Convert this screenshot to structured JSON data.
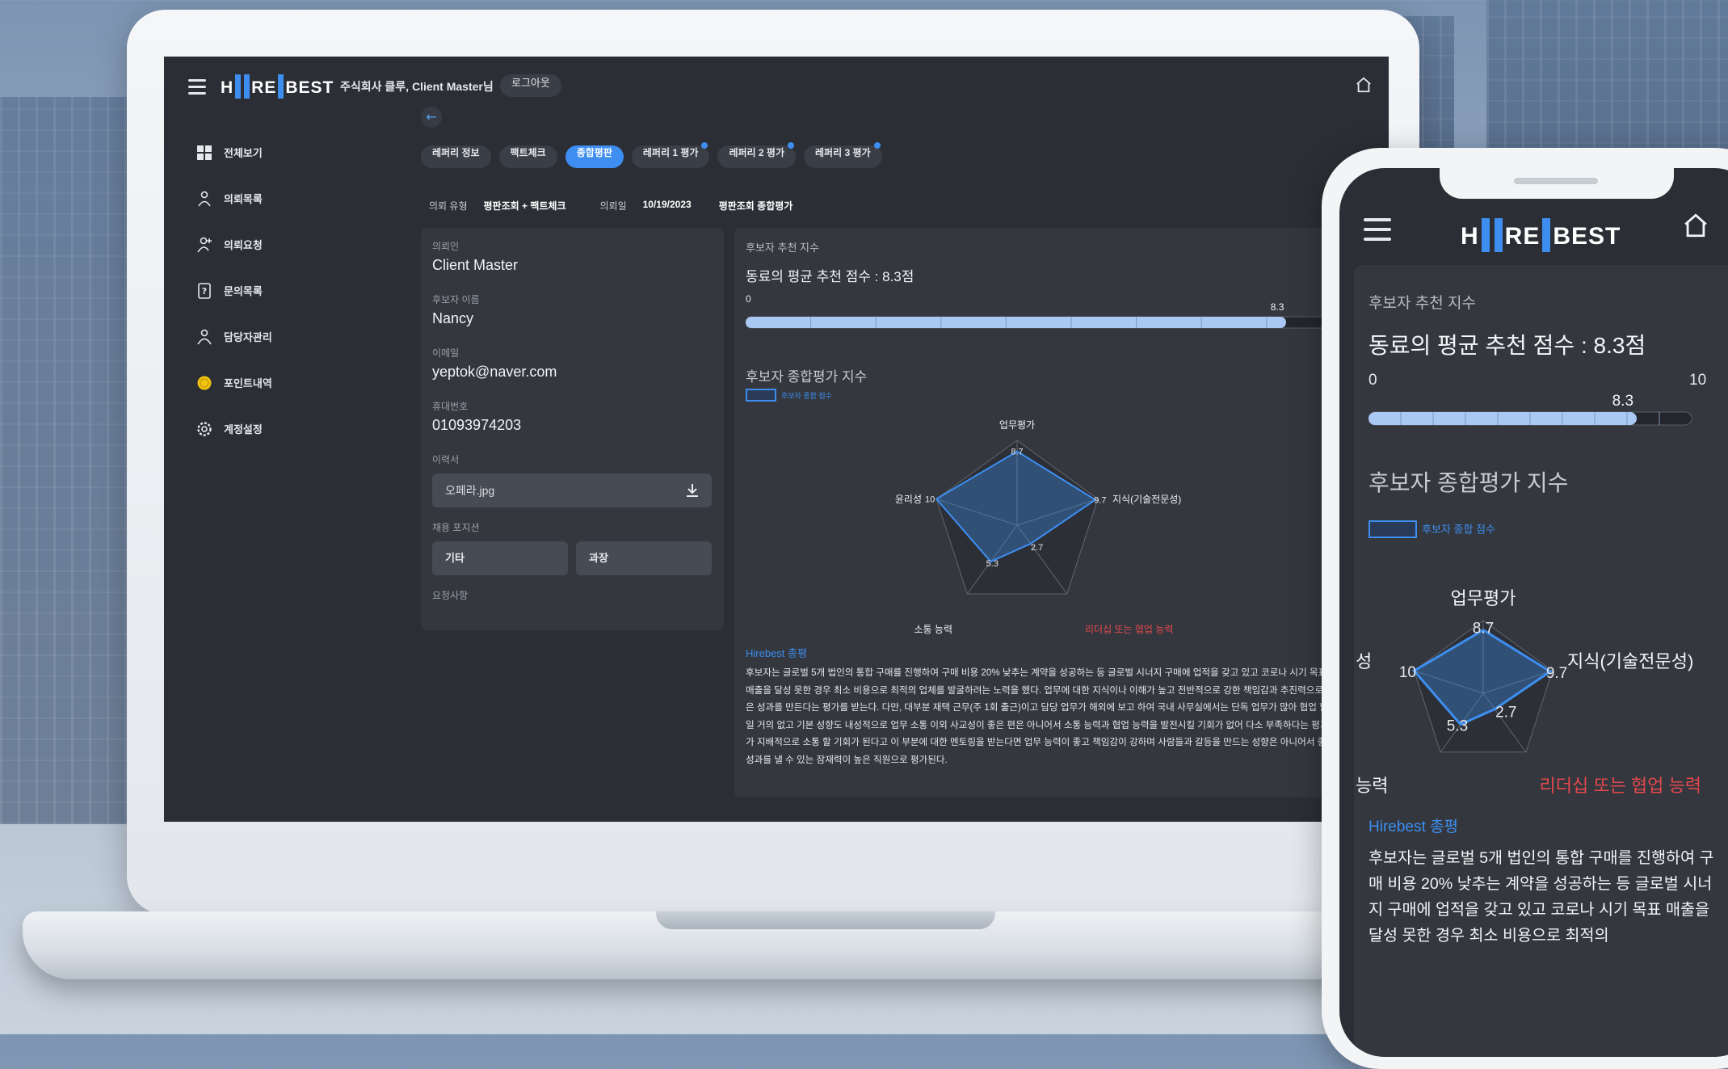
{
  "header": {
    "company": "주식회사 클루, Client Master님",
    "logout": "로그아웃",
    "logo_left": "H",
    "logo_mid": "RE",
    "logo_right": "BEST"
  },
  "sidebar": {
    "items": [
      {
        "label": "전체보기",
        "icon": "grid-icon"
      },
      {
        "label": "의뢰목록",
        "icon": "person-list-icon"
      },
      {
        "label": "의뢰요청",
        "icon": "person-request-icon"
      },
      {
        "label": "문의목록",
        "icon": "question-doc-icon"
      },
      {
        "label": "담당자관리",
        "icon": "manager-icon"
      },
      {
        "label": "포인트내역",
        "icon": "coin-icon"
      },
      {
        "label": "계정설정",
        "icon": "gear-icon"
      }
    ]
  },
  "tabs": [
    {
      "label": "레퍼리 정보"
    },
    {
      "label": "팩트체크"
    },
    {
      "label": "종합평판"
    },
    {
      "label": "레퍼리 1 평가"
    },
    {
      "label": "레퍼리 2 평가"
    },
    {
      "label": "레퍼리 3 평가"
    }
  ],
  "active_tab": "종합평판",
  "meta": {
    "type_label": "의뢰 유형",
    "type_value": "평판조회 + 팩트체크",
    "date_label": "의뢰일",
    "date_value": "10/19/2023",
    "section_value": "평판조회 종합평가"
  },
  "info": {
    "client_label": "의뢰인",
    "client_value": "Client Master",
    "name_label": "후보자 이름",
    "name_value": "Nancy",
    "email_label": "이메일",
    "email_value": "yeptok@naver.com",
    "phone_label": "휴대번호",
    "phone_value": "01093974203",
    "resume_label": "이력서",
    "resume_file": "오페라.jpg",
    "position_label": "채용 포지션",
    "position_1": "기타",
    "position_2": "과장",
    "request_label": "요청사항"
  },
  "evaluation": {
    "rec_title": "후보자 추천 지수",
    "rec_headline": "동료의 평균 추천 점수 : 8.3점",
    "rec_score": 8.3,
    "rec_min": "0",
    "rec_max": "10",
    "rec_score_label": "8.3",
    "overall_title": "후보자 종합평가 지수",
    "legend": "후보자 종합 점수",
    "hirebest_title": "Hirebest 총평",
    "hirebest_desktop": "후보자는 글로벌 5개 법인의 통합 구매를 진행하여 구매 비용 20% 낮추는 계약을 성공하는 등 글로벌 시너지 구매에 업적을 갖고 있고 코로나 시기 목표 매출을 달성 못한 경우 최소 비용으로 최적의 업체를 발굴하려는 노력을 했다. 업무에 대한 지식이나 이해가 높고 전반적으로 강한 책임감과 추진력으로 좋은 성과를 만든다는 평가를 받는다. 다만, 대부분 재택 근무(주 1회 출근)이고 담당 업무가 해외에 보고 하여 국내 사무실에서는 단독 업무가 많아 협업 할일 거의 없고 기본 성향도 내성적으로 업무 소통 이외 사교성이 좋은 편은 아니어서 소통 능력과 협업 능력을 발전시킬 기회가 없어 다소 부족하다는 평가가 지배적으로 소통 할 기회가 된다고 이 부분에 대한 멘토링을 받는다면 업무 능력이 좋고 책임감이 강하며 사람들과 갈등을 만드는 성향은 아니어서 좋은 성과를 낼 수 있는 잠재력이 높은 직원으로 평가된다.",
    "hirebest_mobile": "후보자는 글로벌 5개 법인의 통합 구매를 진행하여 구매 비용 20% 낮추는 계약을 성공하는 등 글로벌 시너지 구매에 업적을 갖고 있고 코로나 시기 목표 매출을 달성 못한 경우 최소 비용으로 최적의"
  },
  "chart_data": {
    "type": "radar",
    "categories": [
      "업무평가",
      "지식(기술전문성)",
      "리더십 또는 협업 능력",
      "소통 능력",
      "윤리성"
    ],
    "series": [
      {
        "name": "후보자 종합 점수",
        "values": [
          8.7,
          9.7,
          2.7,
          5.3,
          10
        ]
      }
    ],
    "rlim": [
      0,
      10
    ],
    "value_labels": [
      "8.7",
      "9.7",
      "2.7",
      "5.3",
      "10"
    ],
    "highlight_category": "리더십 또는 협업 능력",
    "highlight_color": "#e5484d",
    "series_color": "#3d8ef0"
  },
  "mobile_chart_labels": {
    "top": "업무평가",
    "right": "지식(기술전문성)",
    "bottom_right": "리더십 또는 협업 능력",
    "bottom_left_partial": "능력",
    "left_partial": "성"
  },
  "colors": {
    "accent": "#3d8ef0",
    "panel": "#34373e",
    "screen": "#2b2e34",
    "warning": "#e5484d"
  }
}
